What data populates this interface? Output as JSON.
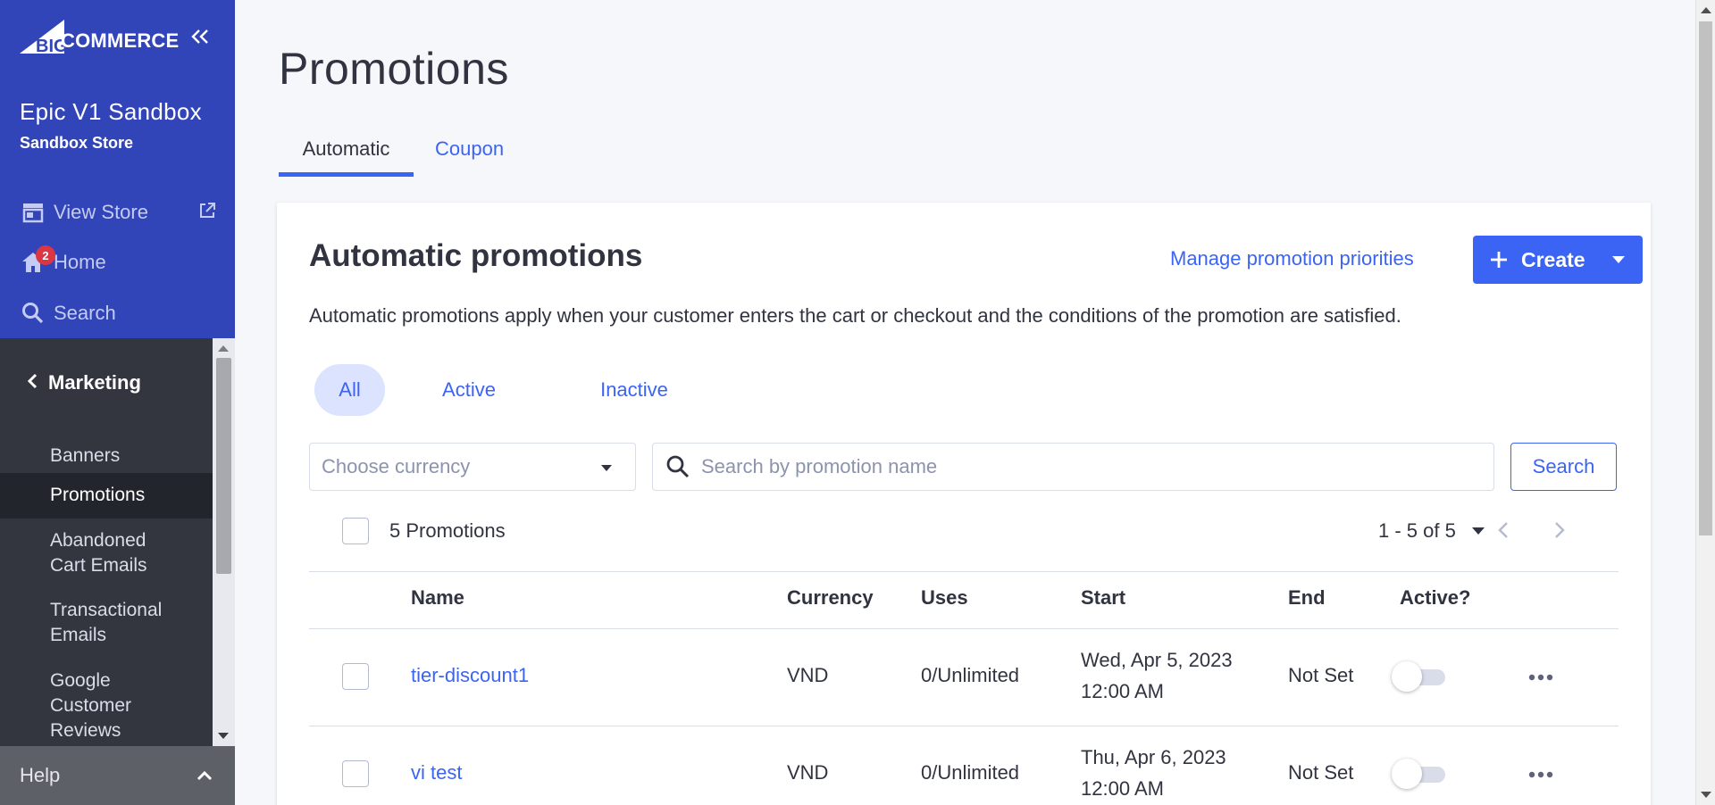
{
  "sidebar": {
    "logo_text": "COMMERCE",
    "logo_prefix": "BIG",
    "store_name": "Epic V1 Sandbox",
    "store_type": "Sandbox Store",
    "view_store": "View Store",
    "home": "Home",
    "home_badge": "2",
    "search": "Search",
    "section": "Marketing",
    "items": [
      {
        "label": "Banners"
      },
      {
        "label": "Promotions"
      },
      {
        "label": "Abandoned Cart Emails"
      },
      {
        "label": "Transactional Emails"
      },
      {
        "label": "Google Customer Reviews"
      }
    ],
    "help": "Help",
    "colors": {
      "brand": "#3245b8",
      "dark": "#34363f",
      "badge": "#db3643"
    }
  },
  "page": {
    "title": "Promotions",
    "tabs": [
      {
        "label": "Automatic",
        "selected": true
      },
      {
        "label": "Coupon",
        "selected": false
      }
    ]
  },
  "panel": {
    "title": "Automatic promotions",
    "manage_link": "Manage promotion priorities",
    "create_label": "Create",
    "description": "Automatic promotions apply when your customer enters the cart or checkout and the conditions of the promotion are satisfied.",
    "filters": [
      {
        "label": "All",
        "selected": true
      },
      {
        "label": "Active",
        "selected": false
      },
      {
        "label": "Inactive",
        "selected": false
      }
    ],
    "currency_placeholder": "Choose currency",
    "search_placeholder": "Search by promotion name",
    "search_button": "Search",
    "count_label": "5 Promotions",
    "pagination": "1 - 5 of 5",
    "accent": "#3c64f4"
  },
  "table": {
    "columns": [
      "Name",
      "Currency",
      "Uses",
      "Start",
      "End",
      "Active?"
    ],
    "rows": [
      {
        "name": "tier-discount1",
        "currency": "VND",
        "uses": "0/Unlimited",
        "start_date": "Wed, Apr 5, 2023",
        "start_time": "12:00 AM",
        "end": "Not Set",
        "active": false
      },
      {
        "name": "vi test",
        "currency": "VND",
        "uses": "0/Unlimited",
        "start_date": "Thu, Apr 6, 2023",
        "start_time": "12:00 AM",
        "end": "Not Set",
        "active": false
      }
    ]
  }
}
